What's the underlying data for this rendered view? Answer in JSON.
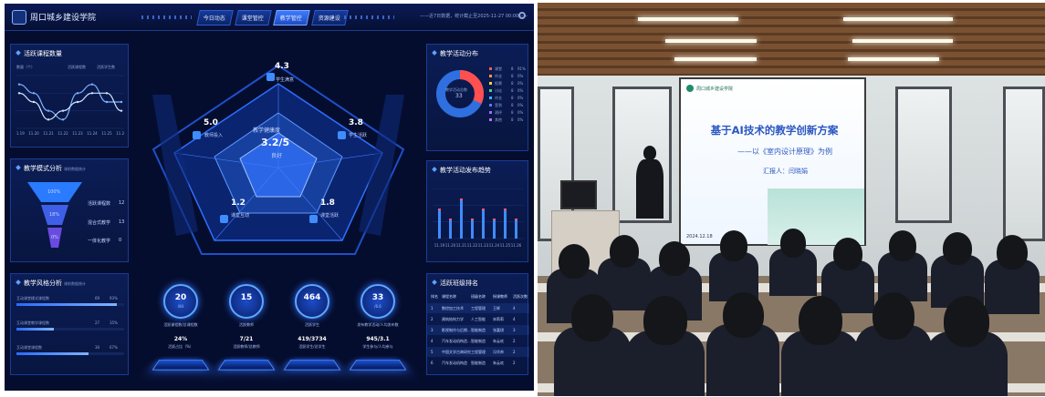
{
  "header": {
    "org_name": "周口城乡建设学院",
    "tabs": [
      "今日动态",
      "课堂管控",
      "教学管控",
      "资源建设"
    ],
    "active_tab": "教学管控",
    "status_text": "——近7日数据，统计截止至2025-11-27 00:00——",
    "settings_label": "设置"
  },
  "panels": {
    "trend": {
      "title": "活跃课程数量",
      "y_unit": "数量（个）",
      "legend": [
        "活跃课程数",
        "活跃学生数"
      ],
      "x_ticks": [
        "11.19",
        "11.20",
        "11.21",
        "11.22",
        "11.23",
        "11.24",
        "11.25",
        "11.26"
      ],
      "series_a": [
        5,
        4,
        2,
        1,
        4,
        5,
        3,
        3
      ],
      "series_b": [
        4,
        3,
        1,
        2,
        3,
        4,
        4,
        2
      ]
    },
    "mode": {
      "title": "教学模式分析",
      "subtitle": "课前数据统计",
      "levels": [
        {
          "pct": "100%",
          "label": "活跃课程数",
          "value": "12"
        },
        {
          "pct": "18%",
          "label": "混合式教学",
          "value": "13"
        },
        {
          "pct": "0%",
          "label": "一体化教学",
          "value": "0"
        }
      ]
    },
    "style": {
      "title": "教学风格分析",
      "subtitle": "课前数据统计",
      "rows": [
        {
          "label": "互动课堂模式课程数",
          "value": "69",
          "pct": "93%",
          "fill": 0.93
        },
        {
          "label": "互动课堂教学课程数",
          "value": "27",
          "pct": "35%",
          "fill": 0.35
        },
        {
          "label": "互动课堂课程数",
          "value": "30",
          "pct": "67%",
          "fill": 0.67
        }
      ]
    },
    "center": {
      "title": "教学健康度",
      "score": "3.2/5",
      "rating": "良好",
      "metrics": [
        {
          "value": "4.3",
          "label": "学生满意"
        },
        {
          "value": "5.0",
          "label": "教师投入"
        },
        {
          "value": "3.8",
          "label": "学生活跃"
        },
        {
          "value": "1.2",
          "label": "课堂互动"
        },
        {
          "value": "1.8",
          "label": "课堂活跃"
        }
      ]
    },
    "cards": [
      {
        "num": "20",
        "unit": "/84",
        "label": "活跃课程数/总课程数",
        "value": "24%",
        "label2": "活跃占比（%）"
      },
      {
        "num": "15",
        "unit": "",
        "label": "活跃教师",
        "value": "7/21",
        "label2": "活跃教师/总教师"
      },
      {
        "num": "464",
        "unit": "",
        "label": "活跃学生",
        "value": "419/3734",
        "label2": "活跃学生/总学生"
      },
      {
        "num": "33",
        "unit": "/6.6",
        "label": "发布教学活动/人均发布数",
        "value": "945/3.1",
        "label2": "学生参与/人均参与"
      }
    ],
    "distribution": {
      "title": "教学活动分布",
      "center_label": "教学活动总数",
      "center_value": "33",
      "legend": [
        {
          "name": "课堂",
          "value": "8",
          "pct": "91%",
          "color": "#ff5a5a"
        },
        {
          "name": "作业",
          "value": "8",
          "pct": "0%",
          "color": "#ff9a3c"
        },
        {
          "name": "投票",
          "value": "8",
          "pct": "0%",
          "color": "#ffd23c"
        },
        {
          "name": "讨论",
          "value": "8",
          "pct": "0%",
          "color": "#4fd18b"
        },
        {
          "name": "作业",
          "value": "8",
          "pct": "0%",
          "color": "#3fb4ff"
        },
        {
          "name": "签到",
          "value": "8",
          "pct": "0%",
          "color": "#4f7dff"
        },
        {
          "name": "测评",
          "value": "8",
          "pct": "0%",
          "color": "#9b6bff"
        },
        {
          "name": "其他",
          "value": "8",
          "pct": "0%",
          "color": "#c06bff"
        }
      ]
    },
    "trend2": {
      "title": "教学活动发布趋势",
      "x_ticks": [
        "11.19",
        "11.20",
        "11.21",
        "11.22",
        "11.23",
        "11.24",
        "11.25",
        "11.26"
      ],
      "values": [
        3,
        2,
        4,
        2,
        3,
        2,
        3,
        2
      ]
    },
    "ranking": {
      "title": "活跃班级排名",
      "headers": [
        "排名",
        "课程名称",
        "班级名称",
        "授课教师",
        "活跃次数"
      ],
      "rows": [
        [
          "1",
          "数控加工技术",
          "工程管理",
          "王辉",
          "4"
        ],
        [
          "2",
          "建筑结构力学",
          "人工智能",
          "宋莉莉",
          "4"
        ],
        [
          "3",
          "影视制作与后期...",
          "智能制造",
          "张嘉琪",
          "3"
        ],
        [
          "4",
          "汽车发动机构造...",
          "智能制造",
          "朱云欢",
          "2"
        ],
        [
          "5",
          "中国文学古典研究",
          "工程管理",
          "冯华帅",
          "2"
        ],
        [
          "6",
          "汽车发动机构造",
          "智能制造",
          "朱云欢",
          "2"
        ]
      ]
    }
  },
  "slide": {
    "org": "周口城乡建设学院",
    "title": "基于AI技术的教学创新方案",
    "subtitle": "——以《室内设计原理》为例",
    "reporter": "汇报人：闫晓娟",
    "date": "2024.12.18"
  },
  "icons": [
    "settings-icon",
    "logo-icon",
    "user-icon",
    "document-icon",
    "flame-icon",
    "star-icon",
    "book-icon"
  ]
}
